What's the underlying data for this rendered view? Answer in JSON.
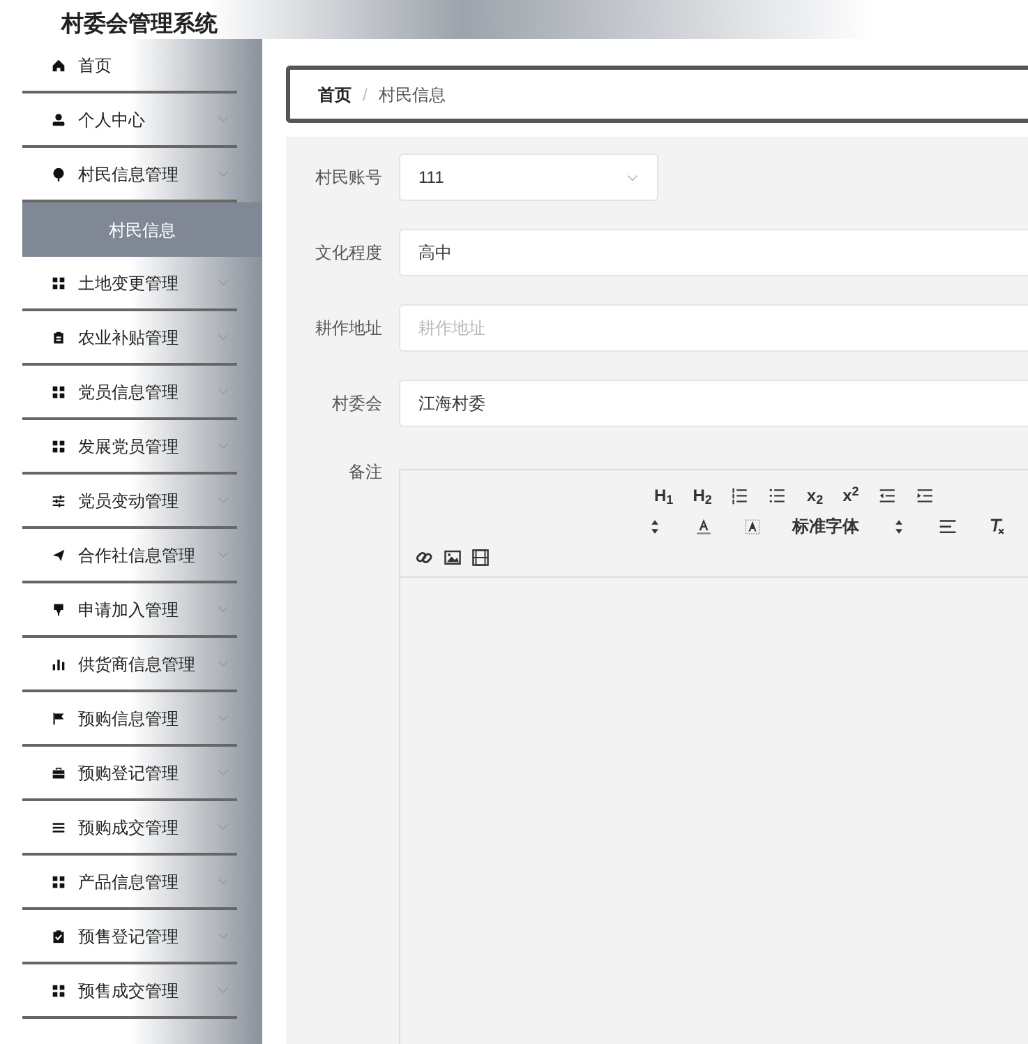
{
  "app_title": "村委会管理系统",
  "sidebar": {
    "items": [
      {
        "label": "首页",
        "has_arrow": false
      },
      {
        "label": "个人中心",
        "has_arrow": true
      },
      {
        "label": "村民信息管理",
        "has_arrow": true,
        "children": [
          {
            "label": "村民信息",
            "selected": true
          }
        ]
      },
      {
        "label": "土地变更管理",
        "has_arrow": true
      },
      {
        "label": "农业补贴管理",
        "has_arrow": true
      },
      {
        "label": "党员信息管理",
        "has_arrow": true
      },
      {
        "label": "发展党员管理",
        "has_arrow": true
      },
      {
        "label": "党员变动管理",
        "has_arrow": true
      },
      {
        "label": "合作社信息管理",
        "has_arrow": true
      },
      {
        "label": "申请加入管理",
        "has_arrow": true
      },
      {
        "label": "供货商信息管理",
        "has_arrow": true
      },
      {
        "label": "预购信息管理",
        "has_arrow": true
      },
      {
        "label": "预购登记管理",
        "has_arrow": true
      },
      {
        "label": "预购成交管理",
        "has_arrow": true
      },
      {
        "label": "产品信息管理",
        "has_arrow": true
      },
      {
        "label": "预售登记管理",
        "has_arrow": true
      },
      {
        "label": "预售成交管理",
        "has_arrow": true
      }
    ]
  },
  "breadcrumb": [
    {
      "label": "首页"
    },
    {
      "label": "村民信息"
    }
  ],
  "breadcrumb_separator": "/",
  "form": {
    "fields": [
      {
        "label": "村民账号",
        "kind": "select",
        "value": "111"
      },
      {
        "label": "文化程度",
        "kind": "input",
        "value": "高中"
      },
      {
        "label": "耕作地址",
        "kind": "input",
        "placeholder": "耕作地址"
      },
      {
        "label": "村委会",
        "kind": "input",
        "value": "江海村委"
      }
    ],
    "editor": {
      "label": "备注",
      "toolbar_texts": [
        "H$_{1}$",
        "H$_{2}$",
        "x$_{2}$",
        "x$^{2}$",
        "标准字体"
      ]
    }
  }
}
